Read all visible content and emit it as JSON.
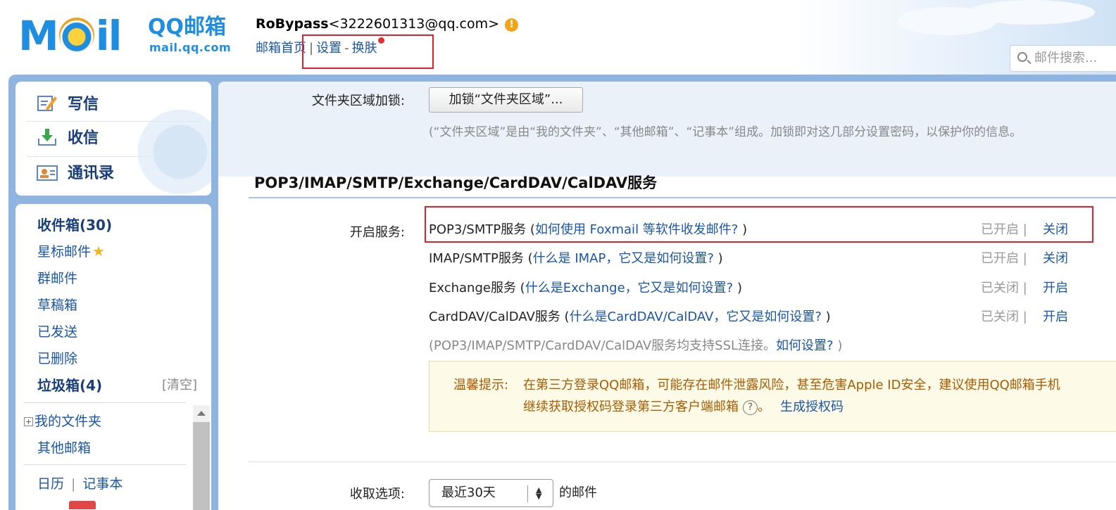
{
  "header": {
    "logo_text": "M  il",
    "logo_brand": "QQ邮箱",
    "logo_domain": "mail.qq.com",
    "user_name": "RoBypass",
    "user_email": "<3222601313@qq.com>",
    "warn_icon_text": "!",
    "links": {
      "home": "邮箱首页",
      "separator": "|",
      "settings": "设置",
      "dash": "-",
      "skin": "换肤"
    },
    "search_placeholder": "邮件搜索..."
  },
  "sidebar": {
    "quick": [
      {
        "label": "写信",
        "icon": "compose-icon"
      },
      {
        "label": "收信",
        "icon": "receive-icon"
      },
      {
        "label": "通讯录",
        "icon": "contacts-icon"
      }
    ],
    "folders": {
      "inbox": "收件箱(30)",
      "starred": "星标邮件",
      "starred_icon": "★",
      "group": "群邮件",
      "drafts": "草稿箱",
      "sent": "已发送",
      "deleted": "已删除",
      "spam": "垃圾箱(4)",
      "clear": "[清空]",
      "tree_plus": "+",
      "my_folders": "我的文件夹",
      "other_mailboxes": "其他邮箱",
      "calendar": "日历",
      "separator": "|",
      "notepad": "记事本"
    }
  },
  "main": {
    "folder_lock_label": "文件夹区域加锁:",
    "folder_lock_button": "加锁“文件夹区域”...",
    "folder_lock_note": "(“文件夹区域”是由“我的文件夹”、“其他邮箱”、“记事本”组成。加锁即对这几部分设置密码，以保护你的信息。",
    "section_title": "POP3/IMAP/SMTP/Exchange/CardDAV/CalDAV服务",
    "services_label": "开启服务:",
    "services": [
      {
        "name": "POP3/SMTP服务 (",
        "link": "如何使用 Foxmail 等软件收发邮件?",
        "close": " )",
        "status": "已开启 |",
        "action": "关闭"
      },
      {
        "name": "IMAP/SMTP服务 (",
        "link": "什么是 IMAP，它又是如何设置?",
        "close": " )",
        "status": "已开启 |",
        "action": "关闭"
      },
      {
        "name": "Exchange服务 (",
        "link": "什么是Exchange，它又是如何设置?",
        "close": " )",
        "status": "已关闭 |",
        "action": "开启"
      },
      {
        "name": "CardDAV/CalDAV服务 (",
        "link": "什么是CardDAV/CalDAV，它又是如何设置?",
        "close": " )",
        "status": "已关闭 |",
        "action": "开启"
      }
    ],
    "ssl_note_text": "(POP3/IMAP/SMTP/CardDAV/CalDAV服务均支持SSL连接。",
    "ssl_note_link": "如何设置?",
    "ssl_note_close": " )",
    "tip_label": "温馨提示:",
    "tip_line1": "在第三方登录QQ邮箱，可能存在邮件泄露风险，甚至危害Apple ID安全，建议使用QQ邮箱手机",
    "tip_line2": "继续获取授权码登录第三方客户端邮箱",
    "tip_help_icon": "?",
    "tip_line2_suffix": "。",
    "tip_link": "生成授权码",
    "receive_label": "收取选项:",
    "receive_select": "最近30天",
    "receive_arrows": "▲▼",
    "receive_suffix": "的邮件"
  },
  "colors": {
    "accent_blue": "#1a56a8",
    "frame_blue": "#8fb4df",
    "highlight_red": "#e0202a",
    "tip_text": "#a85b00",
    "tip_bg": "#fefae8"
  }
}
